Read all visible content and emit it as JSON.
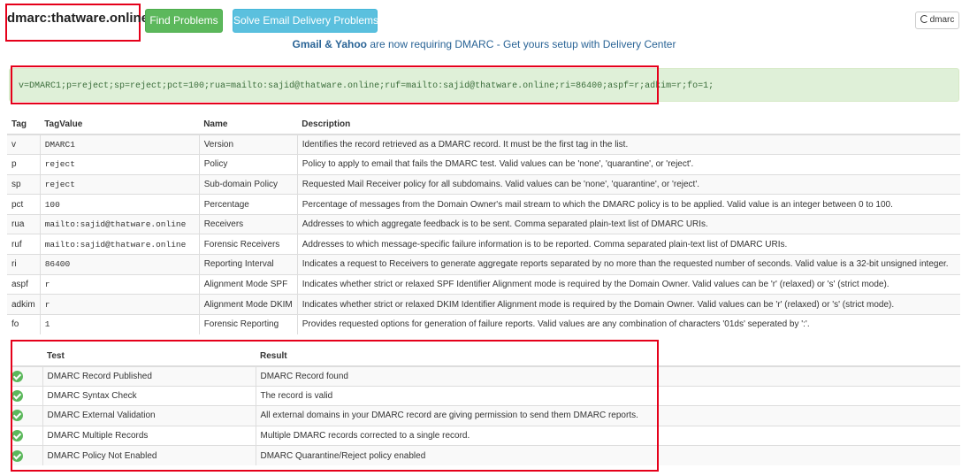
{
  "header": {
    "domain": "dmarc:thatware.online",
    "find_label": "Find Problems",
    "solve_label": "Solve Email Delivery Problems",
    "dmarc_label": "dmarc"
  },
  "promo": {
    "prefix": "Gmail & Yahoo",
    "suffix": " are now requiring DMARC - Get yours setup with Delivery Center"
  },
  "record": "v=DMARC1;p=reject;sp=reject;pct=100;rua=mailto:sajid@thatware.online;ruf=mailto:sajid@thatware.online;ri=86400;aspf=r;adkim=r;fo=1;",
  "tag_table": {
    "headers": [
      "Tag",
      "TagValue",
      "Name",
      "Description"
    ],
    "rows": [
      [
        "v",
        "DMARC1",
        "Version",
        "Identifies the record retrieved as a DMARC record. It must be the first tag in the list."
      ],
      [
        "p",
        "reject",
        "Policy",
        "Policy to apply to email that fails the DMARC test. Valid values can be 'none', 'quarantine', or 'reject'."
      ],
      [
        "sp",
        "reject",
        "Sub-domain Policy",
        "Requested Mail Receiver policy for all subdomains. Valid values can be 'none', 'quarantine', or 'reject'."
      ],
      [
        "pct",
        "100",
        "Percentage",
        "Percentage of messages from the Domain Owner's mail stream to which the DMARC policy is to be applied. Valid value is an integer between 0 to 100."
      ],
      [
        "rua",
        "mailto:sajid@thatware.online",
        "Receivers",
        "Addresses to which aggregate feedback is to be sent. Comma separated plain-text list of DMARC URIs."
      ],
      [
        "ruf",
        "mailto:sajid@thatware.online",
        "Forensic Receivers",
        "Addresses to which message-specific failure information is to be reported. Comma separated plain-text list of DMARC URIs."
      ],
      [
        "ri",
        "86400",
        "Reporting Interval",
        "Indicates a request to Receivers to generate aggregate reports separated by no more than the requested number of seconds. Valid value is a 32-bit unsigned integer."
      ],
      [
        "aspf",
        "r",
        "Alignment Mode SPF",
        "Indicates whether strict or relaxed SPF Identifier Alignment mode is required by the Domain Owner. Valid values can be 'r' (relaxed) or 's' (strict mode)."
      ],
      [
        "adkim",
        "r",
        "Alignment Mode DKIM",
        "Indicates whether strict or relaxed DKIM Identifier Alignment mode is required by the Domain Owner. Valid values can be 'r' (relaxed) or 's' (strict mode)."
      ],
      [
        "fo",
        "1",
        "Forensic Reporting",
        "Provides requested options for generation of failure reports. Valid values are any combination of characters '01ds' seperated by ':'."
      ]
    ]
  },
  "test_table": {
    "headers": [
      "",
      "Test",
      "Result"
    ],
    "status_icon": "check-circle-icon",
    "status_color": "#5cb85c",
    "rows": [
      [
        "DMARC Record Published",
        "DMARC Record found"
      ],
      [
        "DMARC Syntax Check",
        "The record is valid"
      ],
      [
        "DMARC External Validation",
        "All external domains in your DMARC record are giving permission to send them DMARC reports."
      ],
      [
        "DMARC Multiple Records",
        "Multiple DMARC records corrected to a single record."
      ],
      [
        "DMARC Policy Not Enabled",
        "DMARC Quarantine/Reject policy enabled"
      ]
    ]
  },
  "highlight_color": "#e5001a"
}
